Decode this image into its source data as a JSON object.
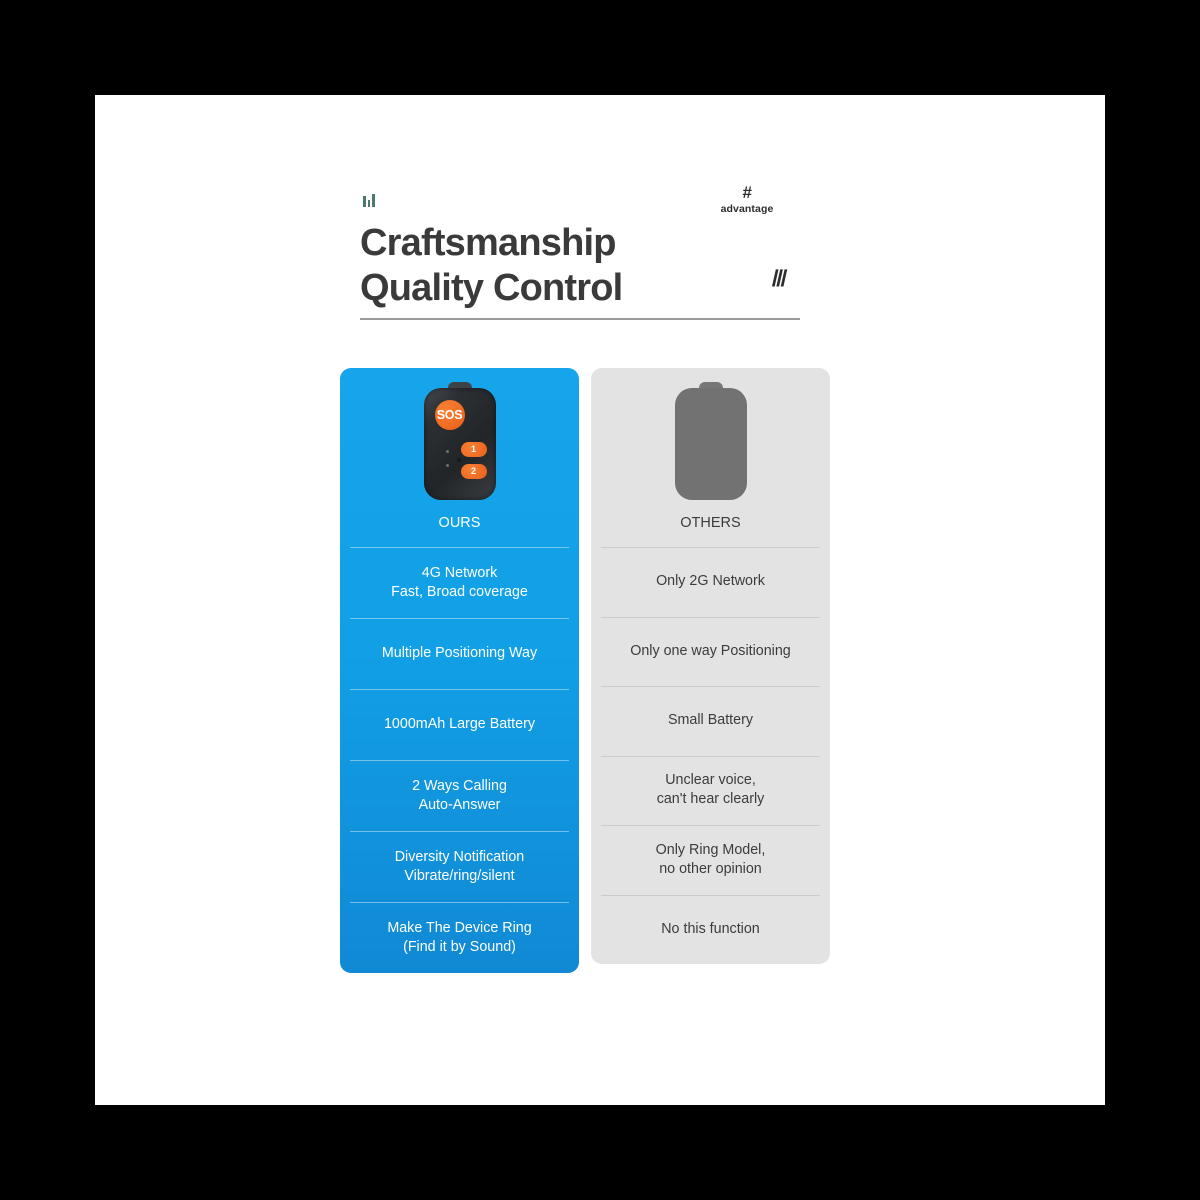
{
  "header": {
    "tick_mark_icon": "three-bars-icon",
    "hash_symbol": "#",
    "hash_label": "advantage",
    "title": "Craftsmanship\nQuality Control",
    "slashes": "///"
  },
  "comparison": {
    "ours": {
      "label": "OURS",
      "device_icon": "gps-tracker-device",
      "device": {
        "sos_label": "SOS",
        "button_1_label": "1",
        "button_2_label": "2"
      },
      "accent_color": "#11a0e6",
      "features": [
        "4G Network\nFast, Broad coverage",
        "Multiple Positioning Way",
        "1000mAh Large Battery",
        "2 Ways Calling\nAuto-Answer",
        "Diversity Notification\nVibrate/ring/silent",
        "Make The Device Ring\n(Find it by Sound)"
      ]
    },
    "others": {
      "label": "OTHERS",
      "device_icon": "generic-device-silhouette",
      "accent_color": "#e3e3e3",
      "features": [
        "Only 2G Network",
        "Only one way Positioning",
        "Small Battery",
        "Unclear voice,\ncan't hear clearly",
        "Only Ring Model,\nno other opinion",
        "No this function"
      ]
    }
  }
}
